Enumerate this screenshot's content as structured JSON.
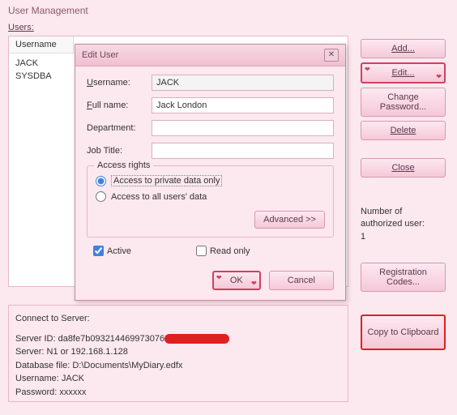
{
  "window": {
    "title": "User Management"
  },
  "users": {
    "label": "Users:",
    "column_header": "Username",
    "list": [
      "JACK",
      "SYSDBA"
    ]
  },
  "buttons": {
    "add": "Add...",
    "edit": "Edit...",
    "change_password": "Change Password...",
    "delete": "Delete",
    "close": "Close",
    "registration": "Registration Codes...",
    "copy": "Copy to Clipboard"
  },
  "stats": {
    "label": "Number of authorized user:",
    "count": "1"
  },
  "server": {
    "connect_label": "Connect to Server:",
    "server_id_label": "Server ID:",
    "server_id_value": "da8fe7b093214469973076",
    "server_label": "Server:",
    "server_value": "N1 or 192.168.1.128",
    "db_label": "Database file:",
    "db_value": "D:\\Documents\\MyDiary.edfx",
    "username_label": "Username:",
    "username_value": "JACK",
    "password_label": "Password:",
    "password_value": "xxxxxx"
  },
  "dialog": {
    "title": "Edit User",
    "username_label": "Username:",
    "username_value": "JACK",
    "fullname_label": "Full name:",
    "fullname_value": "Jack London",
    "department_label": "Department:",
    "department_value": "",
    "jobtitle_label": "Job Title:",
    "jobtitle_value": "",
    "access_legend": "Access rights",
    "access_private": "Access to private data only",
    "access_all": "Access to all users' data",
    "advanced": "Advanced >>",
    "active": "Active",
    "readonly": "Read only",
    "ok": "OK",
    "cancel": "Cancel"
  }
}
